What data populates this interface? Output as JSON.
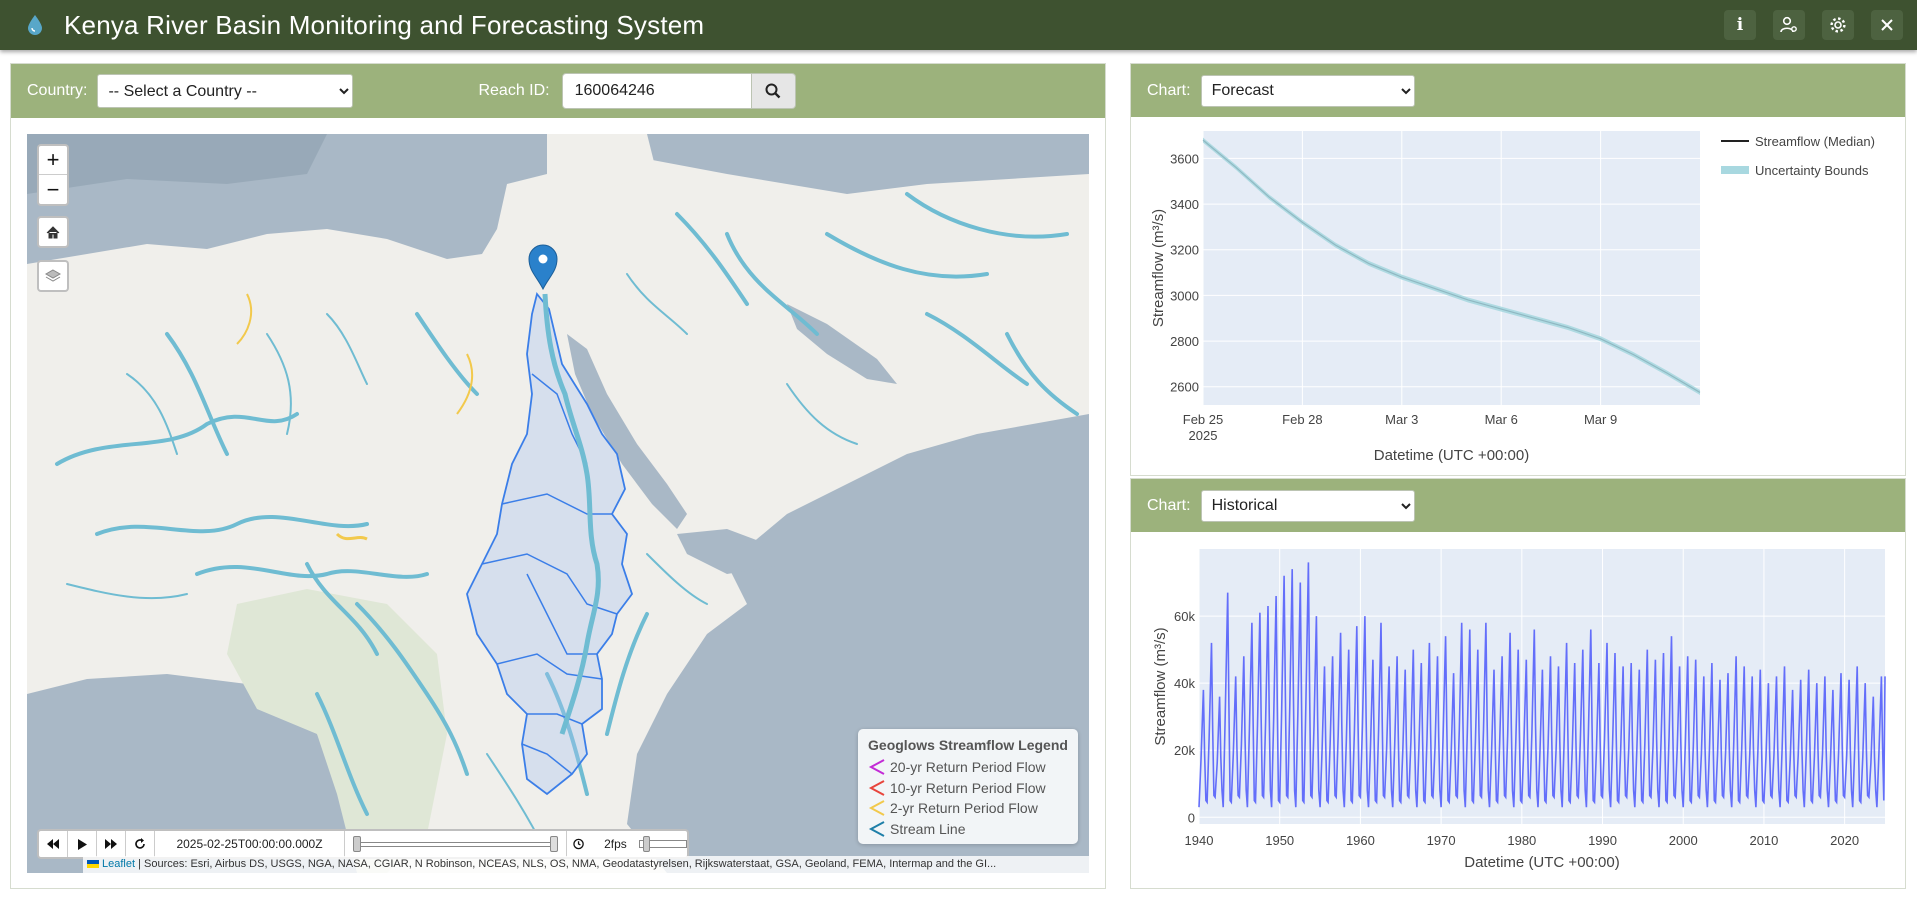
{
  "header": {
    "title": "Kenya River Basin Monitoring and Forecasting System",
    "buttons": [
      "info-icon",
      "user-settings-icon",
      "gear-icon",
      "close-icon"
    ]
  },
  "controls": {
    "country_label": "Country:",
    "country_selected": "-- Select a Country --",
    "reach_label": "Reach ID:",
    "reach_value": "160064246"
  },
  "map": {
    "zoom_in": "+",
    "zoom_out": "−",
    "legend": {
      "title": "Geoglows Streamflow Legend",
      "items": [
        {
          "label": "20-yr Return Period Flow",
          "color": "#c32bd6"
        },
        {
          "label": "10-yr Return Period Flow",
          "color": "#e8453c"
        },
        {
          "label": "2-yr Return Period Flow",
          "color": "#f2c94c"
        },
        {
          "label": "Stream Line",
          "color": "#1f7fa8"
        }
      ]
    },
    "time": {
      "datetime": "2025-02-25T00:00:00.000Z",
      "fps": "2fps"
    },
    "attribution_link": "Leaflet",
    "attribution": "| Sources: Esri, Airbus DS, USGS, NGA, NASA, CGIAR, N Robinson, NCEAS, NLS, OS, NMA, Geodatastyrelsen, Rijkswaterstaat, GSA, Geoland, FEMA, Intermap and the GI..."
  },
  "forecast_panel": {
    "label": "Chart:",
    "selected": "Forecast"
  },
  "historical_panel": {
    "label": "Chart:",
    "selected": "Historical"
  },
  "chart_data": [
    {
      "type": "line",
      "xlabel": "Datetime (UTC +00:00)",
      "ylabel": "Streamflow (m³/s)",
      "x_ticks": [
        "Feb 25",
        "Feb 28",
        "Mar 3",
        "Mar 6",
        "Mar 9"
      ],
      "x_tick_sub": "2025",
      "y_ticks": [
        2600,
        2800,
        3000,
        3200,
        3400,
        3600
      ],
      "xlim": [
        "2025-02-25",
        "2025-03-12"
      ],
      "ylim": [
        2520,
        3720
      ],
      "grid": true,
      "legend_position": "right",
      "series": [
        {
          "name": "Streamflow (Median)",
          "color": "#222222",
          "x": [
            "2025-02-25",
            "2025-02-26",
            "2025-02-27",
            "2025-02-28",
            "2025-03-01",
            "2025-03-02",
            "2025-03-03",
            "2025-03-04",
            "2025-03-05",
            "2025-03-06",
            "2025-03-07",
            "2025-03-08",
            "2025-03-09",
            "2025-03-10",
            "2025-03-11",
            "2025-03-12"
          ],
          "y": [
            3680,
            3560,
            3430,
            3320,
            3220,
            3140,
            3080,
            3030,
            2980,
            2940,
            2900,
            2860,
            2810,
            2740,
            2660,
            2575
          ]
        },
        {
          "name": "Uncertainty Bounds",
          "color": "#a8d8e0"
        }
      ]
    },
    {
      "type": "line",
      "xlabel": "Datetime (UTC +00:00)",
      "ylabel": "Streamflow (m³/s)",
      "x_ticks": [
        1940,
        1950,
        1960,
        1970,
        1980,
        1990,
        2000,
        2010,
        2020
      ],
      "y_ticks": [
        0,
        20000,
        40000,
        60000
      ],
      "y_tick_labels": [
        "0",
        "20k",
        "40k",
        "60k"
      ],
      "xlim": [
        1940,
        2025
      ],
      "ylim": [
        -2000,
        80000
      ],
      "grid": true,
      "series": [
        {
          "color": "#636efa",
          "annual_peaks": [
            [
              1940,
              38000
            ],
            [
              1941,
              52000
            ],
            [
              1942,
              36000
            ],
            [
              1943,
              67000
            ],
            [
              1944,
              42000
            ],
            [
              1945,
              48000
            ],
            [
              1946,
              58000
            ],
            [
              1947,
              61000
            ],
            [
              1948,
              63000
            ],
            [
              1949,
              66000
            ],
            [
              1950,
              72000
            ],
            [
              1951,
              74000
            ],
            [
              1952,
              70000
            ],
            [
              1953,
              76000
            ],
            [
              1954,
              60000
            ],
            [
              1955,
              45000
            ],
            [
              1956,
              48000
            ],
            [
              1957,
              55000
            ],
            [
              1958,
              50000
            ],
            [
              1959,
              57000
            ],
            [
              1960,
              60000
            ],
            [
              1961,
              47000
            ],
            [
              1962,
              58000
            ],
            [
              1963,
              45000
            ],
            [
              1964,
              48000
            ],
            [
              1965,
              44000
            ],
            [
              1966,
              50000
            ],
            [
              1967,
              46000
            ],
            [
              1968,
              52000
            ],
            [
              1969,
              48000
            ],
            [
              1970,
              54000
            ],
            [
              1971,
              43000
            ],
            [
              1972,
              58000
            ],
            [
              1973,
              56000
            ],
            [
              1974,
              50000
            ],
            [
              1975,
              58000
            ],
            [
              1976,
              44000
            ],
            [
              1977,
              48000
            ],
            [
              1978,
              55000
            ],
            [
              1979,
              50000
            ],
            [
              1980,
              47000
            ],
            [
              1981,
              56000
            ],
            [
              1982,
              44000
            ],
            [
              1983,
              48000
            ],
            [
              1984,
              45000
            ],
            [
              1985,
              52000
            ],
            [
              1986,
              46000
            ],
            [
              1987,
              50000
            ],
            [
              1988,
              56000
            ],
            [
              1989,
              46000
            ],
            [
              1990,
              52000
            ],
            [
              1991,
              49000
            ],
            [
              1992,
              45000
            ],
            [
              1993,
              46000
            ],
            [
              1994,
              44000
            ],
            [
              1995,
              50000
            ],
            [
              1996,
              47000
            ],
            [
              1997,
              49000
            ],
            [
              1998,
              54000
            ],
            [
              1999,
              45000
            ],
            [
              2000,
              48000
            ],
            [
              2001,
              47000
            ],
            [
              2002,
              42000
            ],
            [
              2003,
              46000
            ],
            [
              2004,
              41000
            ],
            [
              2005,
              43000
            ],
            [
              2006,
              48000
            ],
            [
              2007,
              45000
            ],
            [
              2008,
              42000
            ],
            [
              2009,
              44000
            ],
            [
              2010,
              40000
            ],
            [
              2011,
              42000
            ],
            [
              2012,
              45000
            ],
            [
              2013,
              38000
            ],
            [
              2014,
              41000
            ],
            [
              2015,
              44000
            ],
            [
              2016,
              40000
            ],
            [
              2017,
              42000
            ],
            [
              2018,
              38000
            ],
            [
              2019,
              43000
            ],
            [
              2020,
              41000
            ],
            [
              2021,
              45000
            ],
            [
              2022,
              40000
            ],
            [
              2023,
              36000
            ],
            [
              2024,
              42000
            ]
          ],
          "annual_min": 3000
        }
      ]
    }
  ]
}
